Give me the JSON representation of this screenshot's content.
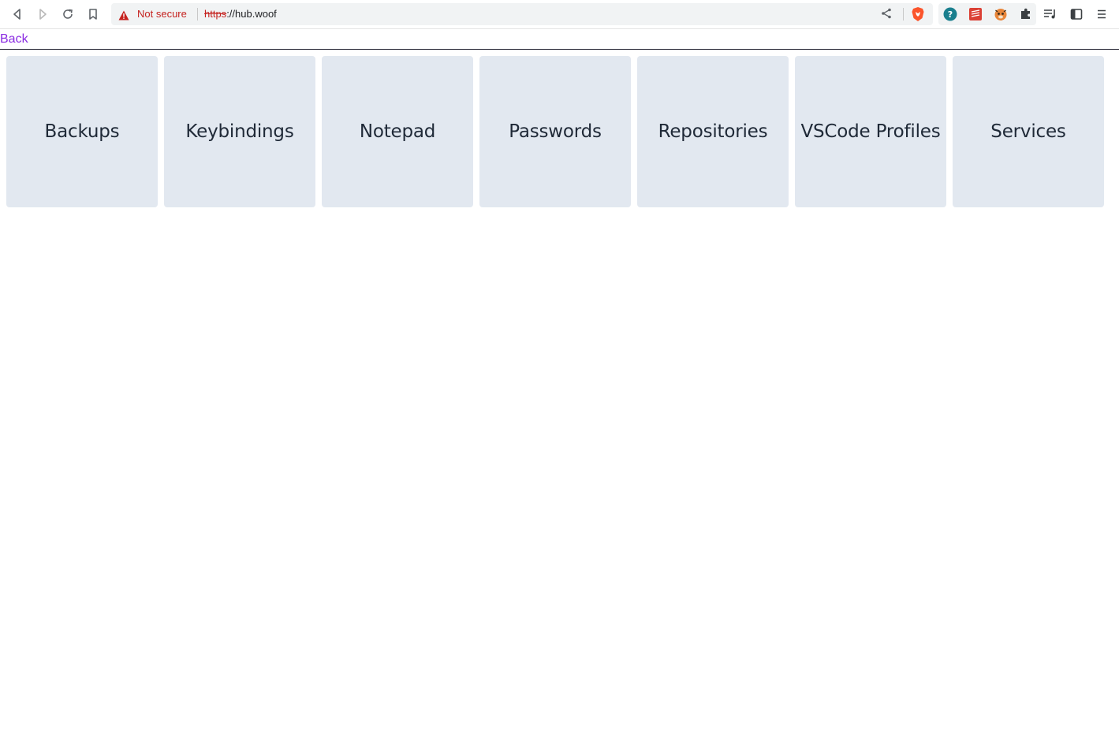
{
  "browser": {
    "security_label": "Not secure",
    "url_scheme": "https",
    "url_rest": "://hub.woof",
    "icons": {
      "back": "back-arrow-icon",
      "forward": "forward-arrow-icon",
      "reload": "reload-icon",
      "bookmark": "bookmark-icon",
      "warning": "warning-icon",
      "share": "share-icon",
      "brave": "brave-shield-icon",
      "extensions": [
        "help-circle-extension-icon",
        "red-stack-extension-icon",
        "tiger-extension-icon",
        "puzzle-extensions-icon"
      ],
      "playlist": "playlist-icon",
      "sidebar": "sidebar-icon",
      "menu": "menu-icon"
    },
    "colors": {
      "warning": "#c5221f",
      "omnibox_bg": "#f1f3f4"
    }
  },
  "page": {
    "back_label": "Back",
    "tiles": [
      {
        "label": "Backups"
      },
      {
        "label": "Keybindings"
      },
      {
        "label": "Notepad"
      },
      {
        "label": "Passwords"
      },
      {
        "label": "Repositories"
      },
      {
        "label": "VSCode Profiles"
      },
      {
        "label": "Services"
      }
    ],
    "colors": {
      "link": "#8a2be2",
      "tile_bg": "#e2e8f0",
      "tile_text": "#1f2937"
    }
  }
}
